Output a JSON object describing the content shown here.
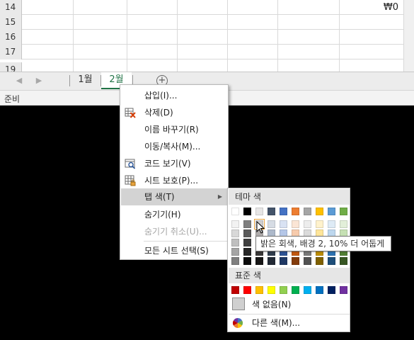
{
  "grid": {
    "rows": [
      {
        "number": "14",
        "value": "₩0"
      },
      {
        "number": "15",
        "value": ""
      },
      {
        "number": "16",
        "value": ""
      },
      {
        "number": "17",
        "value": ""
      },
      {
        "number": "19",
        "value": ""
      }
    ]
  },
  "tabbar": {
    "nav_prev_icon": "chevron-left-icon",
    "nav_next_icon": "chevron-right-icon",
    "sheets": [
      {
        "label": "1월",
        "active": false
      },
      {
        "label": "2월",
        "active": true
      }
    ],
    "add_sheet_symbol": "+"
  },
  "statusbar": {
    "text": "준비"
  },
  "context_menu": {
    "items": [
      {
        "label": "삽입(I)...",
        "icon": "",
        "disabled": false
      },
      {
        "label": "삭제(D)",
        "icon": "delete-sheet-icon",
        "disabled": false
      },
      {
        "label": "이름 바꾸기(R)",
        "icon": "",
        "disabled": false
      },
      {
        "label": "이동/복사(M)...",
        "icon": "",
        "disabled": false
      },
      {
        "label": "코드 보기(V)",
        "icon": "view-code-icon",
        "disabled": false
      },
      {
        "label": "시트 보호(P)...",
        "icon": "protect-sheet-icon",
        "disabled": false
      },
      {
        "label": "탭 색(T)",
        "icon": "",
        "disabled": false,
        "highlighted": true,
        "has_submenu": true
      },
      {
        "label": "숨기기(H)",
        "icon": "",
        "disabled": false
      },
      {
        "label": "숨기기 취소(U)...",
        "icon": "",
        "disabled": true
      },
      {
        "label": "모든 시트 선택(S)",
        "icon": "",
        "disabled": false
      }
    ]
  },
  "tab_color_panel": {
    "theme_header": "테마 색",
    "standard_header": "표준 색",
    "no_color_label": "색 없음(N)",
    "more_colors_label": "다른 색(M)...",
    "theme_base": [
      "#FFFFFF",
      "#000000",
      "#E7E6E6",
      "#44546A",
      "#4472C4",
      "#ED7D31",
      "#A5A5A5",
      "#FFC000",
      "#5B9BD5",
      "#70AD47"
    ],
    "theme_shades": [
      [
        "#F2F2F2",
        "#7F7F7F",
        "#D0CECE",
        "#D6DCE4",
        "#D9E2F3",
        "#FBE5D5",
        "#EDEDED",
        "#FFF2CC",
        "#DEEBF6",
        "#E2EFD9"
      ],
      [
        "#D8D8D8",
        "#595959",
        "#AEABAB",
        "#ADB9CA",
        "#B4C6E7",
        "#F7CBAC",
        "#DBDBDB",
        "#FEE599",
        "#BDD7EE",
        "#C5E0B3"
      ],
      [
        "#BFBFBF",
        "#3F3F3F",
        "#757070",
        "#8496B0",
        "#8EAADB",
        "#F4B183",
        "#C9C9C9",
        "#FFD965",
        "#9CC3E5",
        "#A8D08D"
      ],
      [
        "#A5A5A5",
        "#262626",
        "#3A3838",
        "#323F4F",
        "#2F5496",
        "#C55A11",
        "#7B7B7B",
        "#BF8F00",
        "#2E75B5",
        "#538135"
      ],
      [
        "#7F7F7F",
        "#0C0C0C",
        "#171616",
        "#222A35",
        "#1F3864",
        "#833C0B",
        "#525252",
        "#7F6000",
        "#1E4E79",
        "#375623"
      ]
    ],
    "standard_colors": [
      "#C00000",
      "#FF0000",
      "#FFC000",
      "#FFFF00",
      "#92D050",
      "#00B050",
      "#00B0F0",
      "#0070C0",
      "#002060",
      "#7030A0"
    ]
  },
  "tooltip": {
    "text": "밝은 회색, 배경 2, 10% 더 어둡게"
  }
}
